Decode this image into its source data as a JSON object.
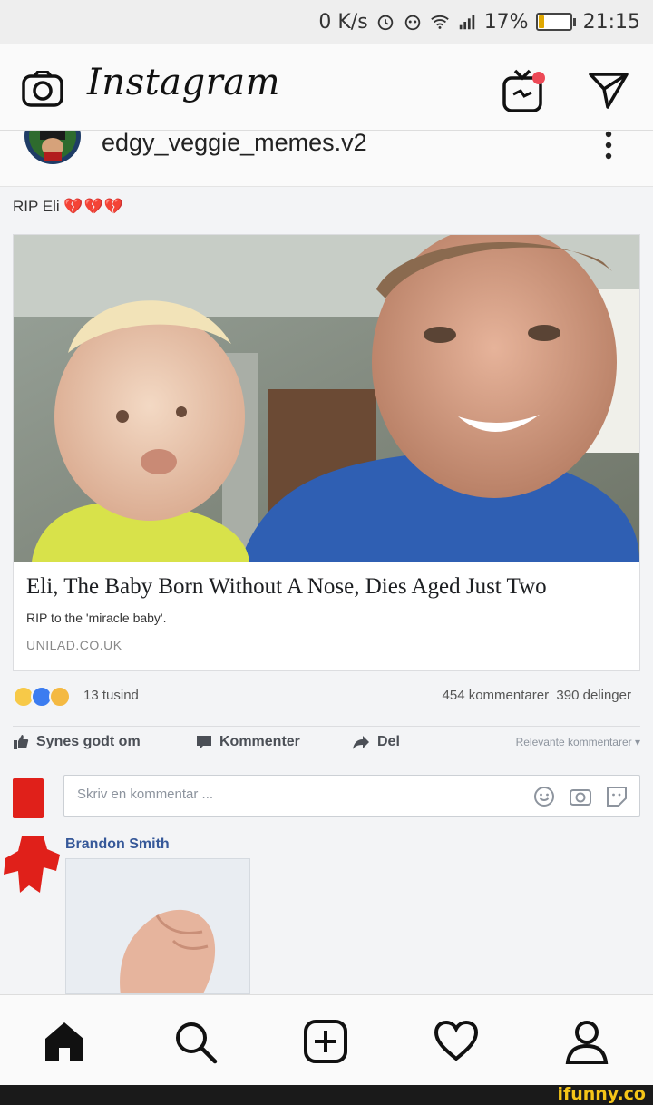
{
  "status_bar": {
    "speed": "0 K/s",
    "battery": "17%",
    "battery_level": 0.17,
    "time": "21:15"
  },
  "header": {
    "logo": "Instagram",
    "icons": [
      "camera-icon",
      "igtv-icon",
      "direct-message-icon"
    ]
  },
  "post": {
    "username": "edgy_veggie_memes.v2",
    "caption": "RIP Eli",
    "caption_emoji": "💔💔💔",
    "article": {
      "headline": "Eli, The Baby Born Without A Nose, Dies Aged Just Two",
      "subline": "RIP to the 'miracle baby'.",
      "domain": "UNILAD.CO.UK"
    },
    "reactions": {
      "count": "13 tusind",
      "comments": "454 kommentarer",
      "shares": "390 delinger"
    },
    "actions": {
      "like": "Synes godt om",
      "comment": "Kommenter",
      "share": "Del",
      "sort": "Relevante kommentarer ▾"
    },
    "comment_placeholder": "Skriv en kommentar ...",
    "comment_author": "Brandon Smith"
  },
  "bottom_nav": [
    "home-icon",
    "search-icon",
    "add-post-icon",
    "activity-heart-icon",
    "profile-icon"
  ],
  "watermark": "ifunny.co",
  "colors": {
    "facebook_link": "#365899",
    "igtv_dot": "#ed4956",
    "ifunny_yellow": "#f5c518"
  }
}
